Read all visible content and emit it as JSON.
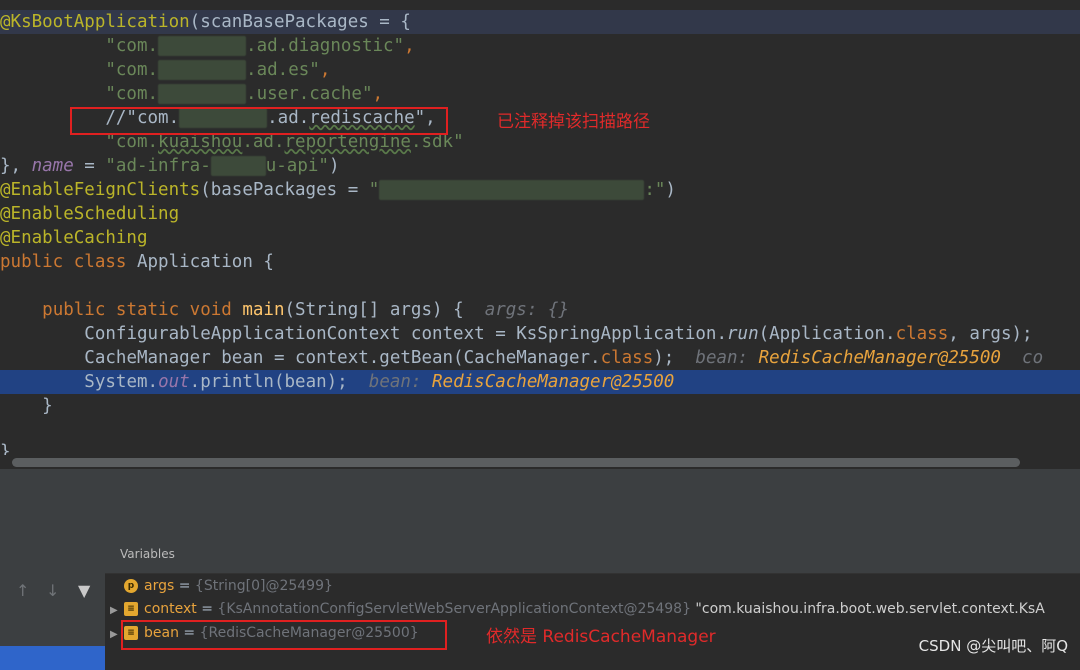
{
  "code": {
    "l1_ann": "@KsBootApplication",
    "l1_rest": "(scanBasePackages = {",
    "pkg1_a": "\"com.",
    "pkg1_b": ".ad.diagnostic\"",
    "pkg1_c": ",",
    "pkg2_a": "\"com.",
    "pkg2_b": ".ad.es\"",
    "pkg2_c": ",",
    "pkg3_a": "\"com.",
    "pkg3_b": ".user.cache\"",
    "pkg3_c": ",",
    "pkg4_a": "//\"com.",
    "pkg4_b": ".ad.",
    "pkg4_c": "rediscache",
    "pkg4_d": "\",",
    "pkg5_a": "\"com.",
    "pkg5_b": "kuaishou",
    "pkg5_c": ".ad.",
    "pkg5_d": "reportengine",
    "pkg5_e": ".sdk\"",
    "close_a": "}, ",
    "close_b": "name",
    "close_c": " = ",
    "close_d": "\"ad-infra-",
    "close_e": "u-api\"",
    "close_f": ")",
    "feign_ann": "@EnableFeignClients",
    "feign_a": "(basePackages = ",
    "feign_b": "\"",
    "feign_c": ":\"",
    "feign_d": ")",
    "sched": "@EnableScheduling",
    "caching": "@EnableCaching",
    "cls_kw": "public class ",
    "cls_name": "Application {",
    "main_kw": "public static void ",
    "main_name": "main",
    "main_sig": "(String[] args) {",
    "main_hint": "args: {}",
    "ctx_a": "ConfigurableApplicationContext context = KsSpringApplication.",
    "ctx_run": "run",
    "ctx_b": "(Application.",
    "ctx_cls": "class",
    "ctx_c": ", args);",
    "bean_a": "CacheManager bean = context.getBean(CacheManager.",
    "bean_cls": "class",
    "bean_b": ");",
    "bean_hint": "bean: ",
    "bean_hintval": "RedisCacheManager@25500",
    "bean_more": "co",
    "println_a": "System.",
    "println_out": "out",
    "println_b": ".println(bean);",
    "println_hint": "bean: ",
    "println_hintval": "RedisCacheManager@25500",
    "brace_method": "}",
    "brace_class": "}"
  },
  "annotations": {
    "note1": "已注释掉该扫描路径",
    "note2": "依然是 RedisCacheManager"
  },
  "debugger": {
    "title": "Variables",
    "icons": [
      "up-arrow-icon",
      "down-arrow-icon",
      "filter-icon"
    ],
    "vars": [
      {
        "name": "args",
        "eq": " = ",
        "value": "{String[0]@25499}",
        "extra": ""
      },
      {
        "name": "context",
        "eq": " = ",
        "value": "{KsAnnotationConfigServletWebServerApplicationContext@25498}",
        "extra": " \"com.kuaishou.infra.boot.web.servlet.context.KsA"
      },
      {
        "name": "bean",
        "eq": " = ",
        "value": "{RedisCacheManager@25500}",
        "extra": ""
      }
    ]
  },
  "watermark": "CSDN @尖叫吧、阿Q",
  "colors": {
    "annotation_red": "#e02020",
    "selection_blue": "#214283"
  }
}
